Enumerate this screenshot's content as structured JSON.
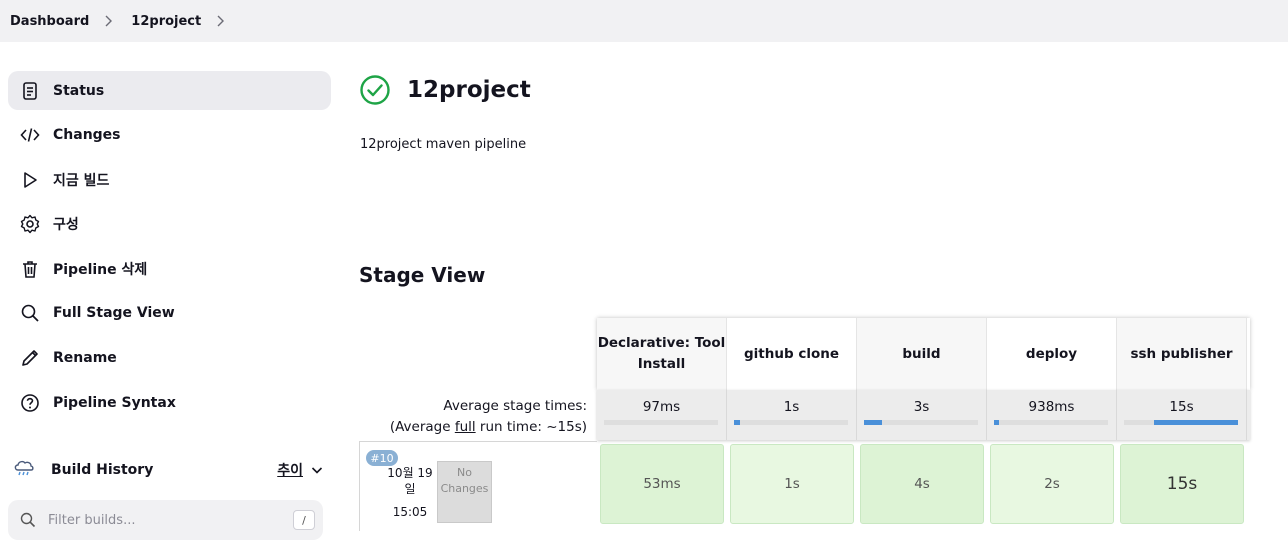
{
  "breadcrumb": [
    "Dashboard",
    "12project"
  ],
  "sidebar": {
    "items": [
      {
        "label": "Status",
        "icon": "document-icon",
        "active": true
      },
      {
        "label": "Changes",
        "icon": "code-icon"
      },
      {
        "label": "지금 빌드",
        "icon": "play-icon"
      },
      {
        "label": "구성",
        "icon": "gear-icon"
      },
      {
        "label": "Pipeline 삭제",
        "icon": "trash-icon"
      },
      {
        "label": "Full Stage View",
        "icon": "search-icon"
      },
      {
        "label": "Rename",
        "icon": "pencil-icon"
      },
      {
        "label": "Pipeline Syntax",
        "icon": "help-icon"
      }
    ]
  },
  "build_history": {
    "title": "Build History",
    "trend": "추이"
  },
  "filter": {
    "placeholder": "Filter builds...",
    "shortcut": "/"
  },
  "project": {
    "title": "12project",
    "description": "12project maven pipeline",
    "status_color": "#1ea446"
  },
  "stage_view": {
    "title": "Stage View",
    "stages": [
      "Declarative: Tool Install",
      "github clone",
      "build",
      "deploy",
      "ssh publisher"
    ],
    "average_label": "Average stage times:",
    "avg_run_prefix": "(Average ",
    "avg_run_link": "full",
    "avg_run_suffix": " run time: ~15s)",
    "averages": [
      "97ms",
      "1s",
      "3s",
      "938ms",
      "15s"
    ],
    "average_fraction": [
      0.0,
      0.05,
      0.16,
      0.04,
      0.74
    ],
    "build": {
      "number": "#10",
      "date": "10월 19 일",
      "time": "15:05",
      "changes": "No Changes",
      "durations": [
        "53ms",
        "1s",
        "4s",
        "2s",
        "15s"
      ]
    }
  }
}
